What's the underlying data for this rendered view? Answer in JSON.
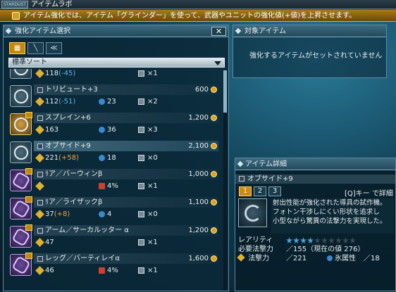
{
  "app": {
    "title": "アイテムラボ",
    "logo": "STARDUST"
  },
  "info": {
    "text": "アイテム強化では、アイテム「グラインダー」を使って、武器やユニットの強化値(+値)を上昇させます。"
  },
  "left_panel": {
    "title": "強化アイテム選択",
    "close": "✕",
    "tabs": [
      "▦",
      "╲",
      "≪"
    ],
    "sort_label": "標準ソート",
    "items": [
      {
        "name": "",
        "price": "",
        "s1": "118",
        "s1_extra": "(-45)",
        "s1_extra_color": "#5ab4f0",
        "s2": "",
        "s3": "×1"
      },
      {
        "name": "トリビュート+3",
        "price": "600",
        "s1": "112",
        "s1_extra": "(-51)",
        "s1_extra_color": "#5ab4f0",
        "s2": "23",
        "s3": "×2"
      },
      {
        "name": "スプレイン+6",
        "price": "1,200",
        "s1": "163",
        "s1_extra": "",
        "s2": "36",
        "s3": "×3"
      },
      {
        "name": "オブサイド+9",
        "price": "2,100",
        "s1": "221",
        "s1_extra": "(+58)",
        "s1_extra_color": "#f0a040",
        "s2": "18",
        "s3": "×0"
      },
      {
        "name": "ﾘア／バーウィンβ",
        "price": "1,000",
        "s1": "",
        "s1_extra": "",
        "s2": "4%",
        "s3": "×1"
      },
      {
        "name": "ﾘア／ライザックβ",
        "price": "1,100",
        "s1": "37",
        "s1_extra": "(+8)",
        "s1_extra_color": "#f0a040",
        "s2": "4",
        "s3": "×0"
      },
      {
        "name": "アーム／サーカルッター α",
        "price": "1,200",
        "s1": "47",
        "s1_extra": "",
        "s2": "",
        "s3": "×1"
      },
      {
        "name": "レッグ／バーティレイα",
        "price": "1,600",
        "s1": "46",
        "s1_extra": "",
        "s2": "4%",
        "s3": "×1"
      }
    ]
  },
  "target_panel": {
    "title": "対象アイテム",
    "message": "強化するアイテムがセットされていません"
  },
  "detail_panel": {
    "title": "アイテム詳細",
    "item_name": "オブサイド+9",
    "pages": [
      "1",
      "2",
      "3"
    ],
    "detail_link": "[Q]キー で詳細",
    "desc": [
      "射出性能が強化された導具の試作機。",
      "フォトン干渉しにくい形状を追求し",
      "小型ながら驚異の法撃力を実現した。"
    ],
    "rarity_label": "レアリティ",
    "rarity": 4,
    "rarity_max": 10,
    "req_label": "必要法撃力",
    "req_value": "／155（現在の値 276）",
    "atk_label": "法撃力",
    "atk_value": "／221",
    "elem_label": "氷属性",
    "elem_value": "／18"
  }
}
